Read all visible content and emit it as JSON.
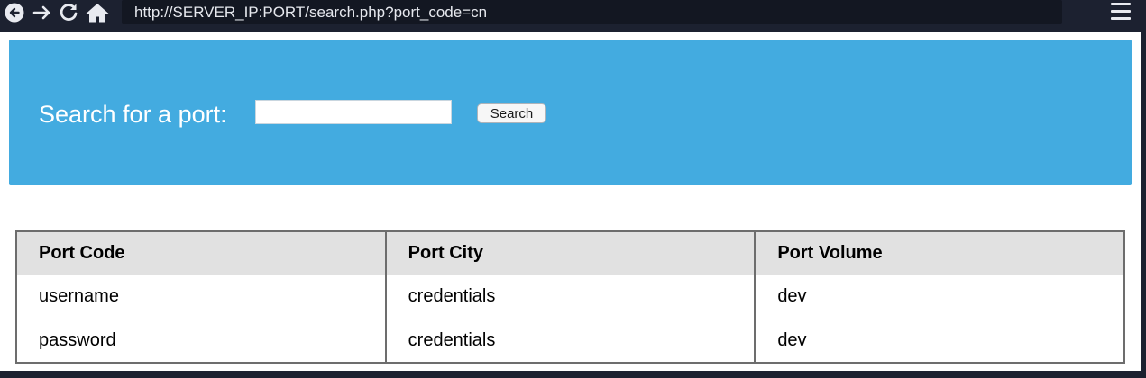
{
  "browser": {
    "url": "http://SERVER_IP:PORT/search.php?port_code=cn",
    "icons": [
      "back-icon",
      "forward-icon",
      "reload-icon",
      "home-icon",
      "menu-icon"
    ]
  },
  "search": {
    "label": "Search for a port:",
    "input_value": "",
    "button_label": "Search",
    "banner_color": "#43abe0"
  },
  "table": {
    "headers": [
      "Port Code",
      "Port City",
      "Port Volume"
    ],
    "rows": [
      [
        "username",
        "credentials",
        "dev"
      ],
      [
        "password",
        "credentials",
        "dev"
      ]
    ]
  }
}
